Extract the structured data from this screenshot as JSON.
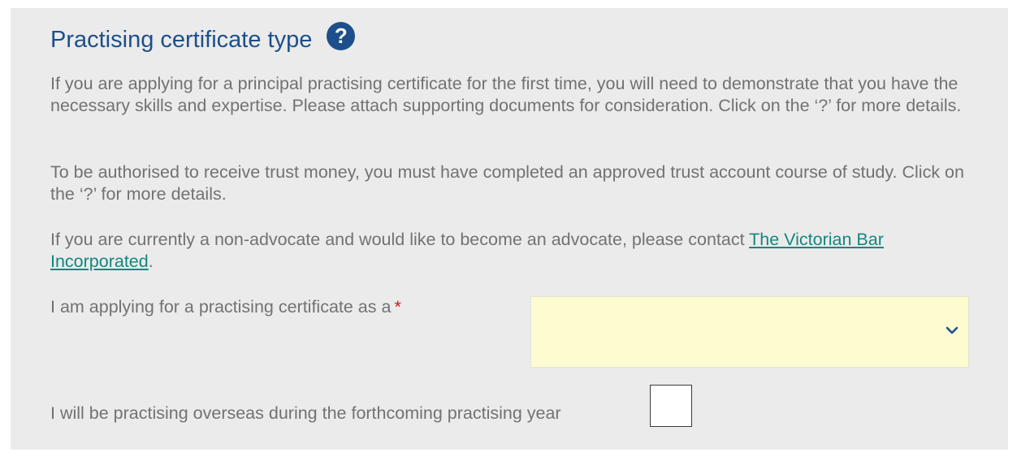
{
  "section": {
    "title": "Practising certificate type",
    "help_icon_glyph": "?"
  },
  "paragraphs": {
    "p1": "If you are applying for a principal practising certificate for the first time, you will need to demonstrate that you have the necessary skills and expertise. Please attach supporting documents for consideration. Click on the ‘?’ for more details.",
    "p2": "To be authorised to receive trust money, you must have completed an approved trust account course of study. Click on the ‘?’ for more details.",
    "p3_prefix": "If you are currently a non-advocate and would like to become an advocate, please contact ",
    "p3_link": "The Victorian Bar Incorporated",
    "p3_suffix": "."
  },
  "form": {
    "certificate_type_label": "I am applying for a practising certificate as a",
    "required_marker": "*",
    "certificate_type_value": "",
    "overseas_label": "I will be practising overseas during the forthcoming practising year",
    "overseas_checked": false
  },
  "colors": {
    "title": "#1d4f8a",
    "help_icon": "#1d4f8a",
    "body_text": "#727272",
    "link": "#13877e",
    "required": "#d11a1a",
    "select_background": "#fdfcd1",
    "panel_background": "#ebebeb"
  },
  "icons": {
    "help": "question-circle-icon",
    "dropdown": "chevron-down-icon"
  }
}
